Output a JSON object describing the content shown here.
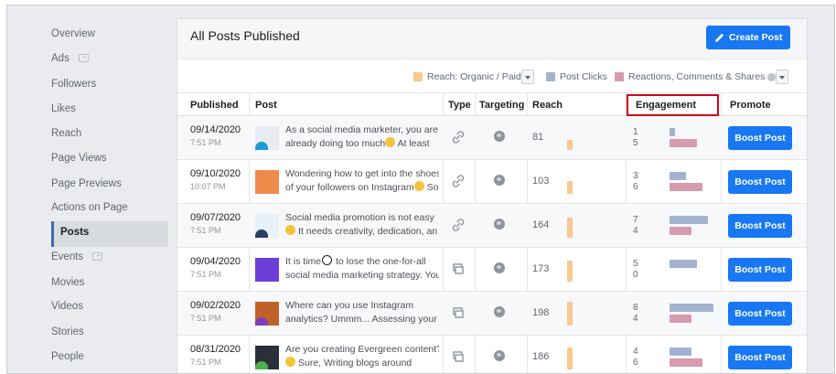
{
  "sidebar": {
    "items": [
      {
        "label": "Overview",
        "external": false
      },
      {
        "label": "Ads",
        "external": true
      },
      {
        "label": "Followers",
        "external": false
      },
      {
        "label": "Likes",
        "external": false
      },
      {
        "label": "Reach",
        "external": false
      },
      {
        "label": "Page Views",
        "external": false
      },
      {
        "label": "Page Previews",
        "external": false
      },
      {
        "label": "Actions on Page",
        "external": false
      },
      {
        "label": "Posts",
        "external": false,
        "active": true
      },
      {
        "label": "Events",
        "external": true
      },
      {
        "label": "Movies",
        "external": false
      },
      {
        "label": "Videos",
        "external": false
      },
      {
        "label": "Stories",
        "external": false
      },
      {
        "label": "People",
        "external": false
      }
    ]
  },
  "header": {
    "title": "All Posts Published",
    "create_label": "Create Post"
  },
  "legend": {
    "reach_label": "Reach: Organic / Paid",
    "clicks_label": "Post Clicks",
    "reactions_label": "Reactions, Comments & Shares"
  },
  "table": {
    "columns": {
      "published": "Published",
      "post": "Post",
      "type": "Type",
      "targeting": "Targeting",
      "reach": "Reach",
      "engagement": "Engagement",
      "promote": "Promote"
    },
    "boost_label": "Boost Post",
    "rows": [
      {
        "date": "09/14/2020",
        "time": "7:51 PM",
        "line1": "As a social media marketer, you are",
        "line2": "already doing too much",
        "line2_after": " At least",
        "thumb": "#e8ecf2",
        "thumb_accent": "#1e9bd7",
        "type": "link",
        "reach": "81",
        "reach_level": 0.41,
        "clicks": "1",
        "reactions": "5",
        "clicks_level": 0.12,
        "reactions_level": 0.62
      },
      {
        "date": "09/10/2020",
        "time": "10:07 PM",
        "line1": "Wondering how to get into the shoes",
        "line2": "of your followers on Instagram",
        "line2_after": " So",
        "thumb": "#f08a4b",
        "thumb_accent": "#f08a4b",
        "type": "link",
        "reach": "103",
        "reach_level": 0.52,
        "clicks": "3",
        "reactions": "6",
        "clicks_level": 0.37,
        "reactions_level": 0.75
      },
      {
        "date": "09/07/2020",
        "time": "7:51 PM",
        "line1": "Social media promotion is not easy",
        "line2": "It needs creativity, dedication, an",
        "line2_after": "",
        "thumb": "#e8f0f8",
        "thumb_accent": "#2c3e66",
        "type": "link",
        "reach": "164",
        "reach_level": 0.83,
        "clicks": "7",
        "reactions": "4",
        "clicks_level": 0.87,
        "reactions_level": 0.5
      },
      {
        "date": "09/04/2020",
        "time": "7:51 PM",
        "line1": "It is time",
        "line1_after": " to lose the one-for-all",
        "line2": "social media marketing strategy. You",
        "line2_after": "",
        "thumb": "#6b3fd8",
        "thumb_accent": "#6b3fd8",
        "type": "photo",
        "reach": "173",
        "reach_level": 0.87,
        "clicks": "5",
        "reactions": "0",
        "clicks_level": 0.62,
        "reactions_level": 0.0
      },
      {
        "date": "09/02/2020",
        "time": "7:51 PM",
        "line1": "Where can you use Instagram",
        "line2": "analytics? Ummm... Assessing your",
        "line2_after": "",
        "thumb": "#c0612a",
        "thumb_accent": "#7a3fb8",
        "type": "photo",
        "reach": "198",
        "reach_level": 1.0,
        "clicks": "8",
        "reactions": "4",
        "clicks_level": 1.0,
        "reactions_level": 0.5
      },
      {
        "date": "08/31/2020",
        "time": "7:51 PM",
        "line1": "Are you creating Evergreen content?",
        "line2": "Sure, Writing blogs around",
        "line2_after": "",
        "thumb": "#2b2f3a",
        "thumb_accent": "#4caf50",
        "type": "photo",
        "reach": "186",
        "reach_level": 0.94,
        "clicks": "4",
        "reactions": "6",
        "clicks_level": 0.5,
        "reactions_level": 0.75
      }
    ]
  },
  "colors": {
    "reach": "#f7c98d",
    "clicks": "#a3b3cf",
    "reactions": "#d79aae",
    "brand_blue": "#1877f2",
    "highlight_red": "#d0021b"
  }
}
